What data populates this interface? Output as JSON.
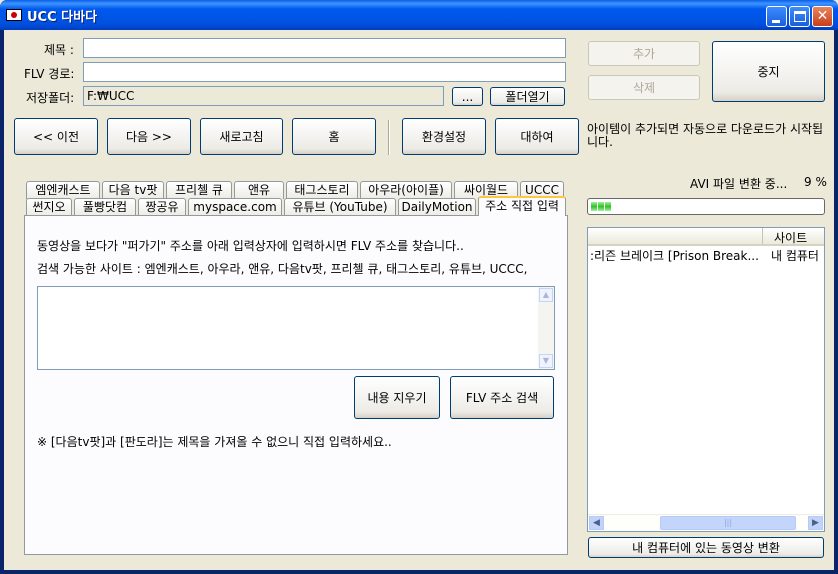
{
  "window": {
    "title": "UCC 다바다"
  },
  "form": {
    "title_label": "제목 :",
    "title_value": "",
    "flv_label": "FLV 경로:",
    "flv_value": "",
    "folder_label": "저장폴더:",
    "folder_value": "F:₩UCC",
    "browse_label": "...",
    "open_folder_label": "폴더열기"
  },
  "side_buttons": {
    "add": "추가",
    "delete": "삭제",
    "stop": "중지"
  },
  "nav": {
    "prev": "<< 이전",
    "next": "다음 >>",
    "refresh": "새로고침",
    "home": "홈",
    "settings": "환경설정",
    "about": "대하여"
  },
  "notice": "아이템이 추가되면 자동으로 다운로드가 시작됩니다.",
  "tabs": {
    "row1": [
      "엠엔캐스트",
      "다음 tv팟",
      "프리첼 큐",
      "앤유",
      "태그스토리",
      "아우라(아이플)",
      "싸이월드",
      "UCCC"
    ],
    "row2": [
      "썬지오",
      "풀빵닷컴",
      "짱공유",
      "myspace.com",
      "유튜브 (YouTube)",
      "DailyMotion",
      "주소 직접 입력"
    ],
    "active": "주소 직접 입력"
  },
  "panel": {
    "line1": "동영상을 보다가 \"퍼가기\" 주소를 아래 입력상자에 입력하시면 FLV 주소를 찾습니다..",
    "line2": "검색 가능한 사이트 : 엠엔캐스트, 아우라, 앤유, 다음tv팟, 프리첼 큐, 태그스토리, 유튜브, UCCC,",
    "textarea_value": "",
    "clear_button": "내용 지우기",
    "search_button": "FLV 주소 검색",
    "footnote": "※ [다음tv팟]과 [판도라]는 제목을 가져올 수 없으니 직접 입력하세요.."
  },
  "status": {
    "text": "AVI 파일 변환 중...",
    "percent": "9 %",
    "progress": 0.09
  },
  "list": {
    "columns": [
      "",
      "사이트"
    ],
    "rows": [
      {
        "title": ":리즌 브레이크 [Prison Break...",
        "site": "내 컴퓨터"
      }
    ]
  },
  "convert_button": "내 컴퓨터에 있는 동영상 변환",
  "colors": {
    "titlebar": "#0054E3",
    "face": "#ECE9D8",
    "progress_fill": "#2FC225",
    "active_tab": "#FFC83C"
  }
}
